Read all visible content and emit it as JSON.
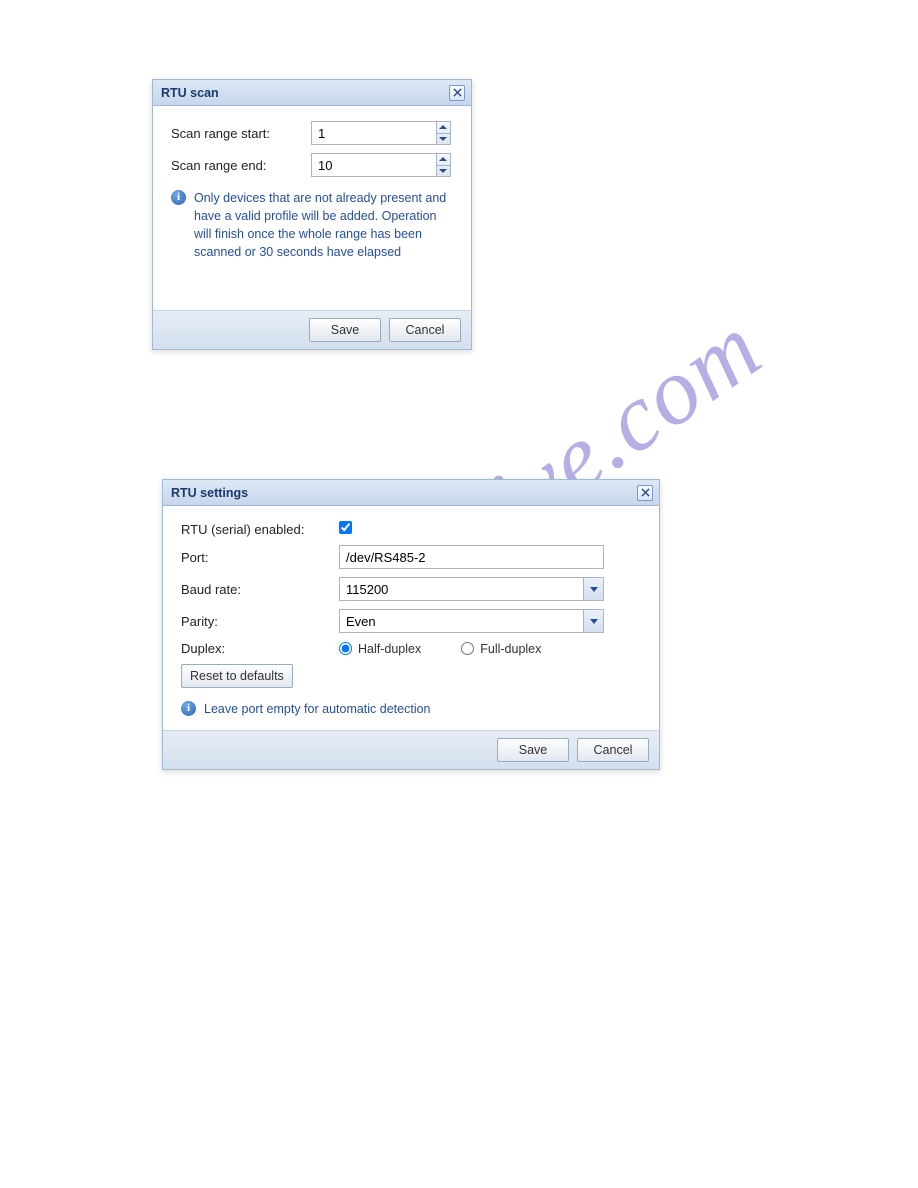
{
  "watermark": "manualshive.com",
  "rtu_scan": {
    "title": "RTU scan",
    "scan_range_start_label": "Scan range start:",
    "scan_range_start_value": "1",
    "scan_range_end_label": "Scan range end:",
    "scan_range_end_value": "10",
    "info_text": "Only devices that are not already present and have a valid profile will be added. Operation will finish once the whole range has been scanned or 30 seconds have elapsed",
    "save_label": "Save",
    "cancel_label": "Cancel"
  },
  "rtu_settings": {
    "title": "RTU settings",
    "enabled_label": "RTU (serial) enabled:",
    "enabled_checked": true,
    "port_label": "Port:",
    "port_value": "/dev/RS485-2",
    "baud_label": "Baud rate:",
    "baud_value": "115200",
    "parity_label": "Parity:",
    "parity_value": "Even",
    "duplex_label": "Duplex:",
    "duplex_half_label": "Half-duplex",
    "duplex_full_label": "Full-duplex",
    "duplex_selected": "half",
    "reset_label": "Reset to defaults",
    "info_text": "Leave port empty for automatic detection",
    "save_label": "Save",
    "cancel_label": "Cancel"
  }
}
